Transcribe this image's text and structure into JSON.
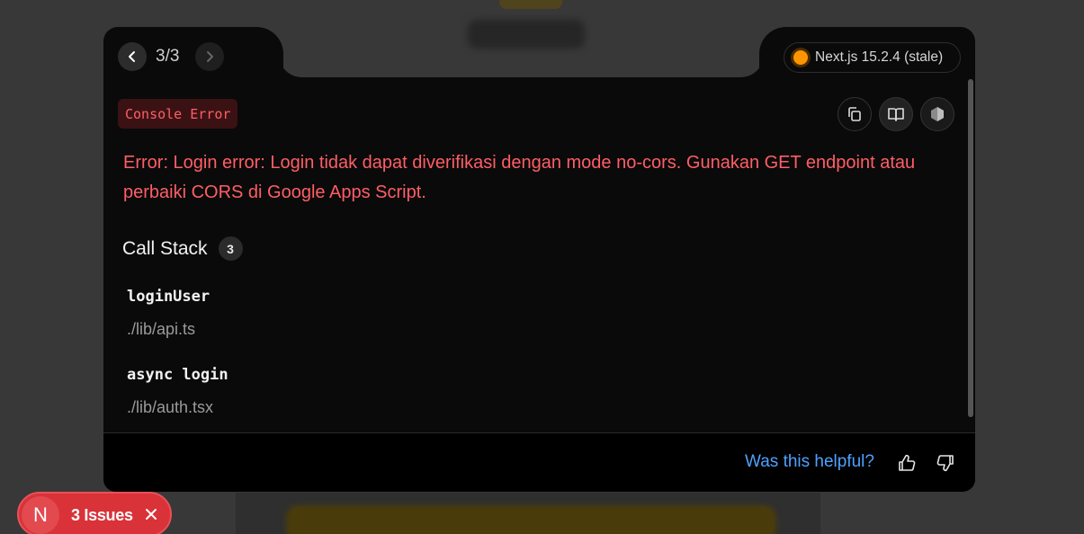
{
  "nav": {
    "counter": "3/3"
  },
  "version": {
    "label": "Next.js 15.2.4 (stale)",
    "status_color": "#ff9500"
  },
  "error": {
    "badge": "Console Error",
    "message": "Error: Login error: Login tidak dapat diverifikasi dengan mode no-cors. Gunakan GET endpoint atau perbaiki CORS di Google Apps Script."
  },
  "toolbar": {
    "copy_icon": "copy-icon",
    "docs_icon": "book-open-icon",
    "node_icon": "nodejs-icon"
  },
  "call_stack": {
    "title": "Call Stack",
    "count": "3",
    "frames": [
      {
        "function": "loginUser",
        "file": "./lib/api.ts"
      },
      {
        "function": "async login",
        "file": "./lib/auth.tsx"
      }
    ]
  },
  "feedback": {
    "label": "Was this helpful?"
  },
  "issues": {
    "logo": "N",
    "label": "3 Issues"
  },
  "colors": {
    "error": "#ff5e66",
    "link": "#4ea1ff",
    "toast": "#d93239"
  }
}
